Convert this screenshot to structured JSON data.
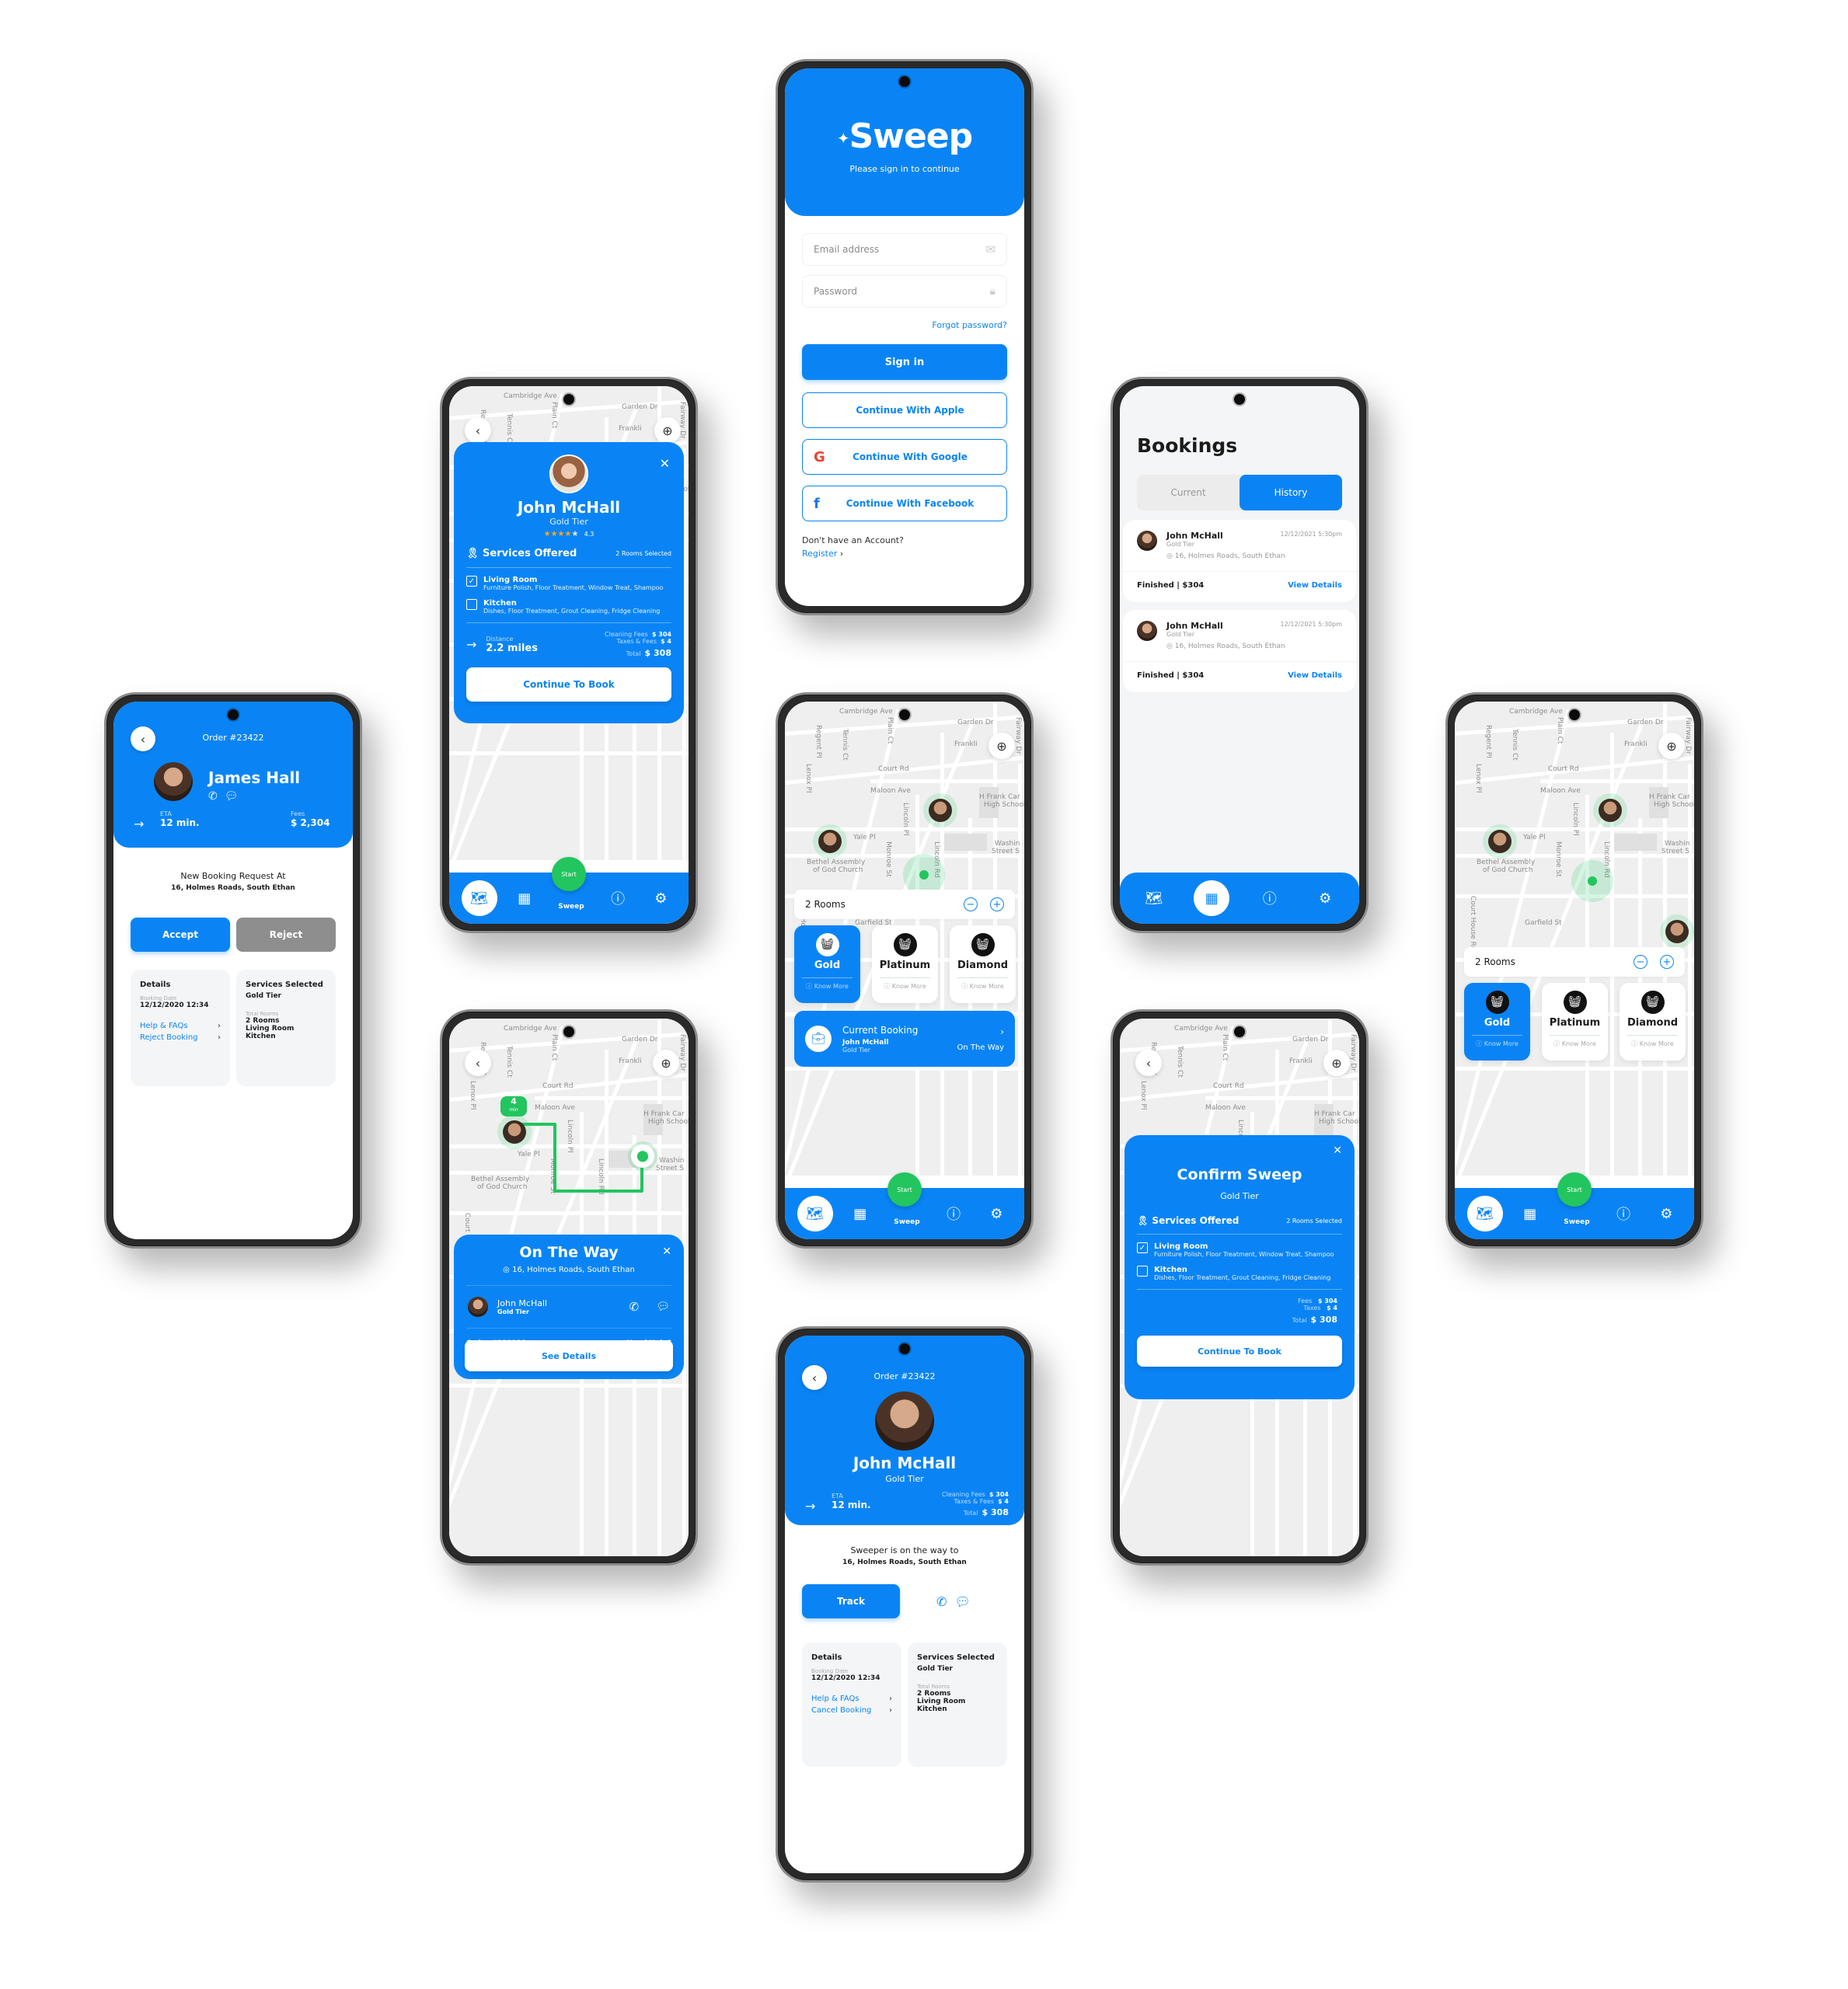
{
  "brand": {
    "name": "Sweep",
    "primary_color": "#0a84f5",
    "accent_green": "#22c55e"
  },
  "signin": {
    "logo": "Sweep",
    "subtitle": "Please sign in to continue",
    "email_placeholder": "Email address",
    "password_placeholder": "Password",
    "forgot": "Forgot password?",
    "signin_btn": "Sign in",
    "apple_btn": "Continue With Apple",
    "google_btn": "Continue With Google",
    "facebook_btn": "Continue With Facebook",
    "no_account": "Don't have an Account?",
    "register": "Register",
    "icons": {
      "email": "mail-icon",
      "password": "lock-icon",
      "apple": "apple-icon",
      "google": "google-icon",
      "facebook": "facebook-icon"
    }
  },
  "map_streets": {
    "cambridge": "Cambridge Ave",
    "garden": "Garden Dr",
    "franklin": "Frankli",
    "fairway": "Fairway Dr",
    "regent": "Regent Pl",
    "tennis": "Tennis Ct",
    "plain": "Plain Ct",
    "lenox": "Lenox Pl",
    "court": "Court Rd",
    "maloon": "Maloon Ave",
    "hfrank": "H Frank Car",
    "hschool": "High School",
    "lincolnpl": "Lincoln Pl",
    "yale": "Yale Pl",
    "monroe": "Monroe St",
    "lincolnrd": "Lincoln Rd",
    "washing": "Washin",
    "streets": "Street S",
    "bethel": "Bethel Assembly",
    "church": "of God Church",
    "garfield": "Garfield St",
    "courthouse": "Court House Rd"
  },
  "nav": {
    "items": [
      {
        "icon": "map-pin-icon",
        "label": ""
      },
      {
        "icon": "boxes-icon",
        "label": ""
      },
      {
        "icon": "sweep",
        "label": "Sweep"
      },
      {
        "icon": "help-icon",
        "label": ""
      },
      {
        "icon": "user-settings-icon",
        "label": ""
      }
    ],
    "start": "Start",
    "sweep": "Sweep"
  },
  "profile_sheet": {
    "name": "John McHall",
    "tier": "Gold Tier",
    "rating": "4.3",
    "stars": 4,
    "services_title": "Services Offered",
    "rooms_selected": "2  Rooms Selected",
    "services": [
      {
        "name": "Living Room",
        "desc": "Furniture Polish, Floor Treatment, Window Treat, Shampoo",
        "checked": true
      },
      {
        "name": "Kitchen",
        "desc": "Dishes, Floor Treatment, Grout Cleaning, Fridge Cleaning",
        "checked": false
      }
    ],
    "distance_label": "Distance",
    "distance": "2.2 miles",
    "cleaning_fees_label": "Cleaning Fees",
    "cleaning_fees": "$ 304",
    "taxes_label": "Taxes & Fees",
    "taxes": "$ 4",
    "total_label": "Total",
    "total": "$ 308",
    "cta": "Continue To Book"
  },
  "bookings": {
    "title": "Bookings",
    "tabs": [
      {
        "label": "Current",
        "active": false
      },
      {
        "label": "History",
        "active": true
      }
    ],
    "items": [
      {
        "name": "John McHall",
        "tier": "Gold Tier",
        "datetime": "12/12/2021 5:30pm",
        "address": "16, Holmes Roads, South Ethan",
        "status": "Finished | $304",
        "action": "View Details"
      },
      {
        "name": "John McHall",
        "tier": "Gold Tier",
        "datetime": "12/12/2021 5:30pm",
        "address": "16, Holmes Roads, South Ethan",
        "status": "Finished | $304",
        "action": "View Details"
      }
    ]
  },
  "request": {
    "order": "Order #23422",
    "name": "James Hall",
    "eta_label": "ETA",
    "eta": "12 min.",
    "fees_label": "Fees",
    "fees": "$ 2,304",
    "heading": "New Booking Request At",
    "address": "16, Holmes Roads, South Ethan",
    "accept": "Accept",
    "reject": "Reject",
    "details_title": "Details",
    "booking_date_label": "Booking Date",
    "booking_date": "12/12/2020 12:34",
    "help": "Help & FAQs",
    "reject_booking": "Reject Booking",
    "services_title": "Services Selected",
    "services_tier": "Gold Tier",
    "total_rooms_label": "Total Rooms",
    "rooms": [
      "2 Rooms",
      "Living Room",
      "Kitchen"
    ]
  },
  "home_map": {
    "rooms": "2 Rooms",
    "tiers": [
      {
        "name": "Gold",
        "more": "Know More",
        "selected": true
      },
      {
        "name": "Platinum",
        "more": "Know More",
        "selected": false
      },
      {
        "name": "Diamond",
        "more": "Know More",
        "selected": false
      }
    ],
    "current_booking": {
      "title": "Current Booking",
      "name": "John McHall",
      "tier": "Gold Tier",
      "status": "On The Way"
    }
  },
  "on_the_way": {
    "title": "On The Way",
    "address": "16, Holmes Roads, South Ethan",
    "eta_badge_num": "4",
    "eta_badge_unit": "min",
    "name": "John McHall",
    "tier": "Gold Tier",
    "order": "Order #232123",
    "help": "Need Help?",
    "cta": "See Details"
  },
  "confirm": {
    "title": "Confirm Sweep",
    "tier": "Gold Tier",
    "services_title": "Services Offered",
    "rooms_selected": "2  Rooms Selected",
    "services": [
      {
        "name": "Living Room",
        "desc": "Furniture Polish, Floor Treatment, Window Treat, Shampoo",
        "checked": true
      },
      {
        "name": "Kitchen",
        "desc": "Dishes, Floor Treatment, Grout Cleaning, Fridge Cleaning",
        "checked": false
      }
    ],
    "fees_label": "Fees",
    "fees": "$ 304",
    "taxes_label": "Taxes",
    "taxes": "$ 4",
    "total_label": "Total",
    "total": "$ 308",
    "cta": "Continue To Book"
  },
  "order_status": {
    "order": "Order #23422",
    "name": "John McHall",
    "tier": "Gold Tier",
    "eta_label": "ETA",
    "eta": "12 min.",
    "cleaning_fees_label": "Cleaning Fees",
    "cleaning_fees": "$ 304",
    "taxes_label": "Taxes & Fees",
    "taxes": "$ 4",
    "total_label": "Total",
    "total": "$ 308",
    "heading": "Sweeper is on the way to",
    "address": "16, Holmes Roads, South Ethan",
    "track": "Track",
    "details_title": "Details",
    "booking_date_label": "Booking Date",
    "booking_date": "12/12/2020 12:34",
    "help": "Help & FAQs",
    "cancel": "Cancel Booking",
    "services_title": "Services Selected",
    "services_tier": "Gold Tier",
    "total_rooms_label": "Total Rooms",
    "rooms": [
      "2 Rooms",
      "Living Room",
      "Kitchen"
    ]
  }
}
